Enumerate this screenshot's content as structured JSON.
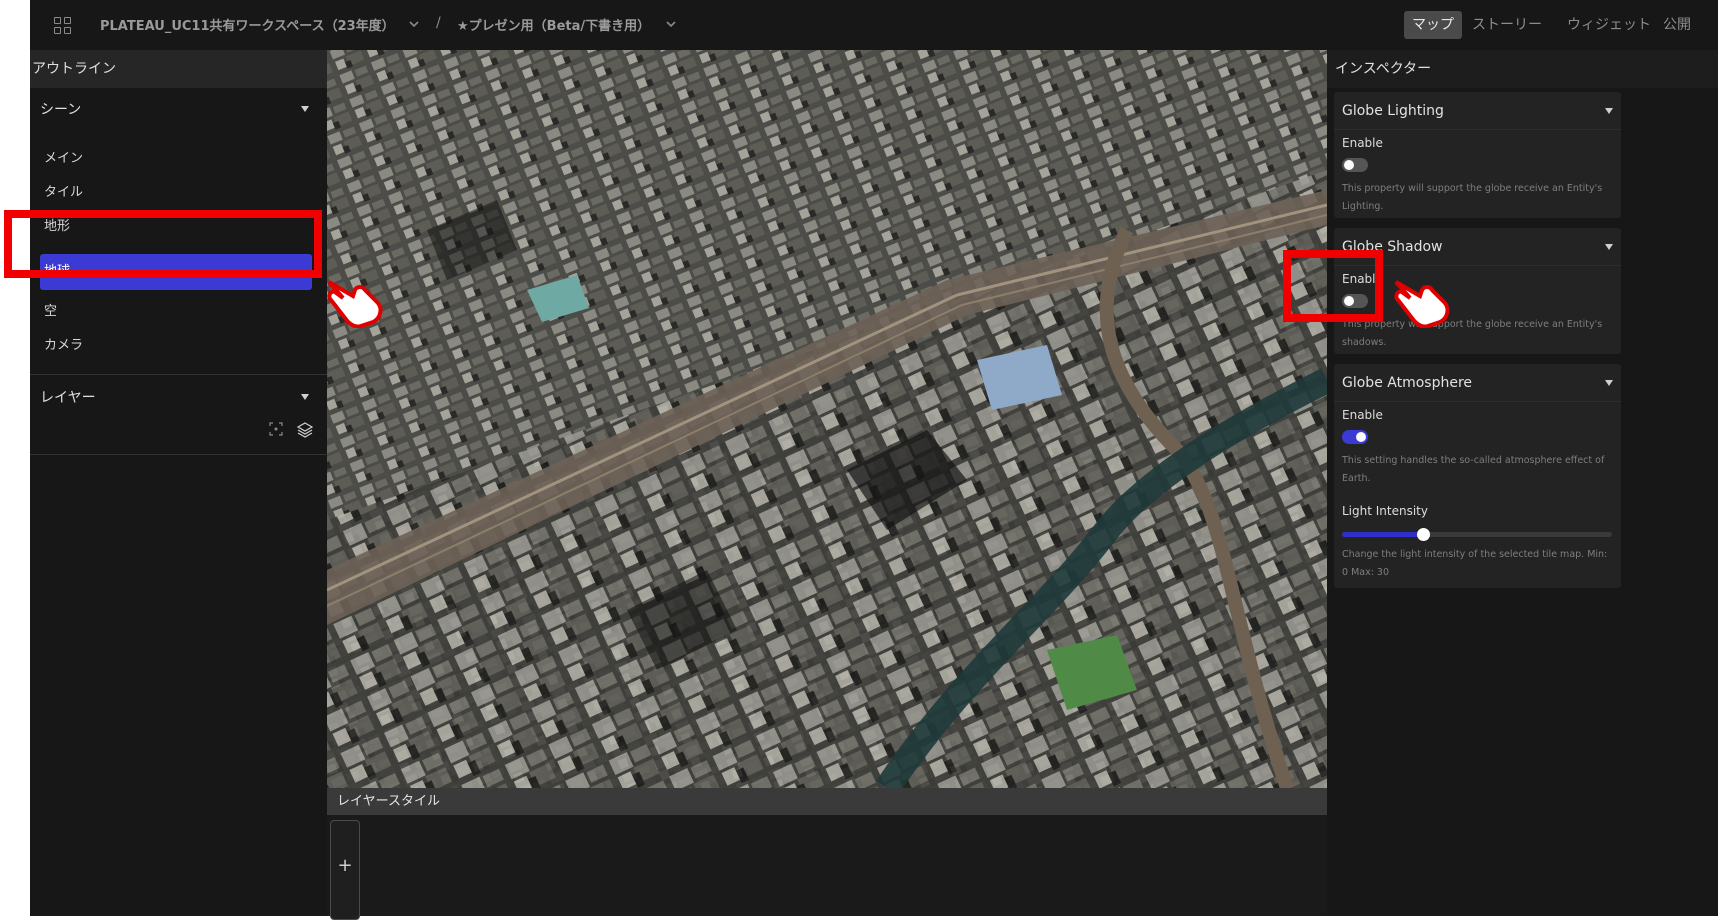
{
  "header": {
    "workspace": "PLATEAU_UC11共有ワークスペース（23年度）",
    "separator": "/",
    "project": "★プレゼン用（Beta/下書き用）",
    "tabs": [
      {
        "label": "マップ",
        "active": true
      },
      {
        "label": "ストーリー",
        "active": false
      },
      {
        "label": "ウィジェット",
        "active": false
      },
      {
        "label": "公開",
        "active": false
      }
    ]
  },
  "outline": {
    "title": "アウトライン",
    "scene": {
      "label": "シーン",
      "items": [
        {
          "label": "メイン"
        },
        {
          "label": "タイル"
        },
        {
          "label": "地形"
        },
        {
          "label": "地球",
          "selected": true
        },
        {
          "label": "空"
        },
        {
          "label": "カメラ"
        }
      ]
    },
    "layer": {
      "label": "レイヤー"
    }
  },
  "layer_style": {
    "title": "レイヤースタイル",
    "add_label": "+"
  },
  "inspector": {
    "title": "インスペクター",
    "lighting": {
      "title": "Globe Lighting",
      "enable_label": "Enable",
      "enabled": false,
      "description": "This property will support the globe receive an Entity's Lighting."
    },
    "shadow": {
      "title": "Globe Shadow",
      "enable_label": "Enable",
      "enabled": false,
      "description": "This property will support the globe receive an Entity's shadows."
    },
    "atmosphere": {
      "title": "Globe Atmosphere",
      "enable_label": "Enable",
      "enabled": true,
      "description": "This setting handles the so-called atmosphere effect of Earth.",
      "intensity_label": "Light Intensity",
      "intensity_value_fraction": 0.3,
      "intensity_description": "Change the light intensity of the selected tile map. Min: 0 Max: 30"
    }
  },
  "colors": {
    "accent": "#3b3bd4",
    "annotation": "#f00000",
    "panel_bg": "#171717"
  },
  "icons": [
    "apps-grid-icon",
    "chevron-down-icon",
    "caret-down-icon",
    "locate-icon",
    "layers-icon",
    "pointing-hand-icon"
  ]
}
